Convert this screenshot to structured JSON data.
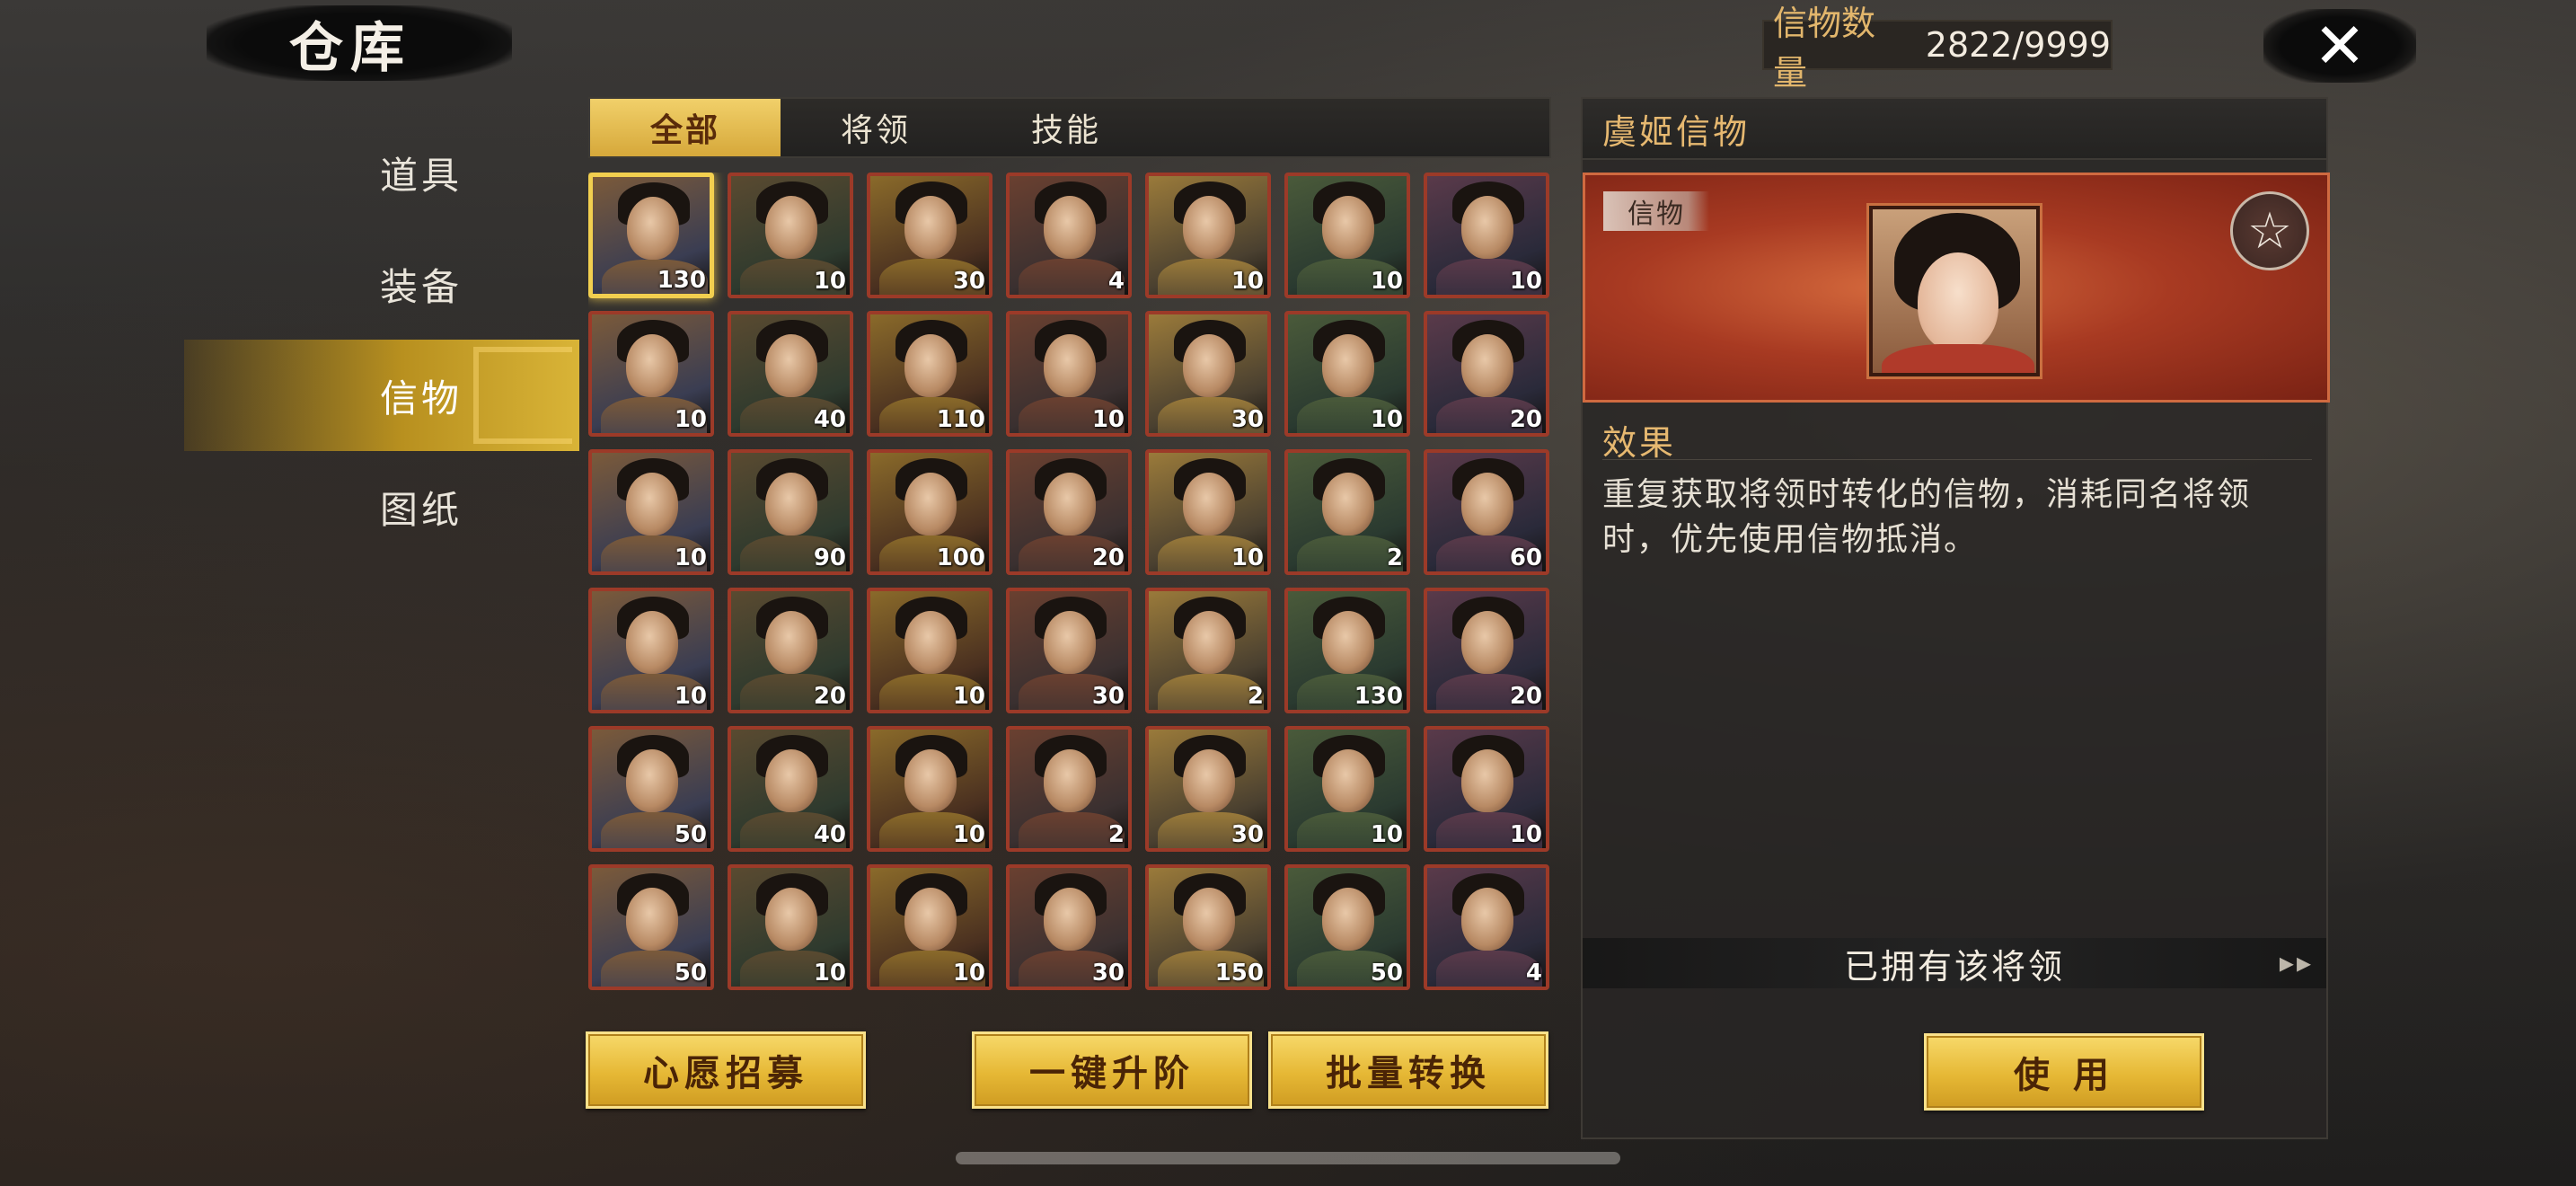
{
  "header": {
    "title": "仓库",
    "count_label": "信物数量",
    "count_value": "2822/9999",
    "close_icon": "close-icon"
  },
  "sidebar": {
    "items": [
      {
        "label": "道具"
      },
      {
        "label": "装备"
      },
      {
        "label": "信物",
        "active": true
      },
      {
        "label": "图纸"
      }
    ]
  },
  "tabs": [
    {
      "label": "全部",
      "active": true
    },
    {
      "label": "将领"
    },
    {
      "label": "技能"
    }
  ],
  "grid": {
    "items": [
      {
        "count": "130"
      },
      {
        "count": "10"
      },
      {
        "count": "30"
      },
      {
        "count": "4"
      },
      {
        "count": "10"
      },
      {
        "count": "10"
      },
      {
        "count": "10"
      },
      {
        "count": "10"
      },
      {
        "count": "40"
      },
      {
        "count": "110"
      },
      {
        "count": "10"
      },
      {
        "count": "30"
      },
      {
        "count": "10"
      },
      {
        "count": "20"
      },
      {
        "count": "10"
      },
      {
        "count": "90"
      },
      {
        "count": "100"
      },
      {
        "count": "20"
      },
      {
        "count": "10"
      },
      {
        "count": "2"
      },
      {
        "count": "60"
      },
      {
        "count": "10"
      },
      {
        "count": "20"
      },
      {
        "count": "10"
      },
      {
        "count": "30"
      },
      {
        "count": "2"
      },
      {
        "count": "130"
      },
      {
        "count": "20"
      },
      {
        "count": "50"
      },
      {
        "count": "40"
      },
      {
        "count": "10"
      },
      {
        "count": "2"
      },
      {
        "count": "30"
      },
      {
        "count": "10"
      },
      {
        "count": "10"
      },
      {
        "count": "50"
      },
      {
        "count": "10"
      },
      {
        "count": "10"
      },
      {
        "count": "30"
      },
      {
        "count": "150"
      },
      {
        "count": "50"
      },
      {
        "count": "4"
      }
    ]
  },
  "buttons": {
    "wish_recruit": "心愿招募",
    "one_key_upgrade": "一键升阶",
    "batch_convert": "批量转换",
    "use": "使 用"
  },
  "detail": {
    "title": "虞姬信物",
    "tag": "信物",
    "star_icon": "star-icon",
    "effect_title": "效果",
    "effect_text": "重复获取将领时转化的信物，消耗同名将领时，优先使用信物抵消。",
    "owned_text": "已拥有该将领"
  },
  "colors": {
    "accent_gold": "#e6b835",
    "banner_red": "#a83a22",
    "frame_red": "#9c3a28"
  }
}
